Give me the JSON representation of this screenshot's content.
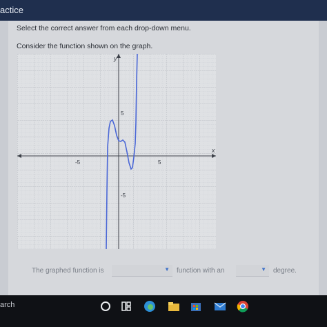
{
  "window": {
    "title": "actice"
  },
  "question": {
    "instruction": "Select the correct answer from each drop-down menu.",
    "prompt": "Consider the function shown on the graph."
  },
  "graph": {
    "x_axis_label": "x",
    "y_axis_label": "y",
    "tick_labels": {
      "x_neg": "-5",
      "x_pos": "5",
      "y_pos": "5",
      "y_neg": "-5"
    },
    "curve_color": "#4a67d6"
  },
  "answer": {
    "part1": "The graphed function is",
    "part2": "function with an",
    "part3": "degree.",
    "dropdown1_value": "",
    "dropdown2_value": ""
  },
  "taskbar": {
    "search_text": "arch",
    "icons": [
      "cortana-icon",
      "task-view-icon",
      "edge-icon",
      "file-explorer-icon",
      "store-icon",
      "mail-icon",
      "chrome-icon"
    ]
  },
  "colors": {
    "accent": "#3f72c9"
  }
}
